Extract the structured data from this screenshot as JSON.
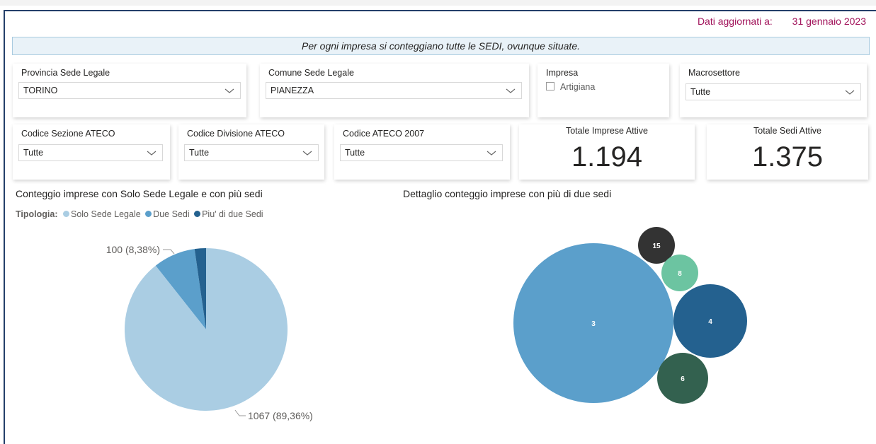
{
  "header": {
    "updated_label": "Dati aggiornati a:",
    "updated_date": "31 gennaio 2023",
    "note": "Per ogni impresa si conteggiano tutte le SEDI, ovunque situate."
  },
  "slicers": {
    "provincia": {
      "title": "Provincia Sede Legale",
      "value": "TORINO"
    },
    "comune": {
      "title": "Comune Sede Legale",
      "value": "PIANEZZA"
    },
    "impresa": {
      "title": "Impresa",
      "option": "Artigiana",
      "checked": false
    },
    "macrosettore": {
      "title": "Macrosettore",
      "value": "Tutte"
    },
    "sezione": {
      "title": "Codice Sezione ATECO",
      "value": "Tutte"
    },
    "divisione": {
      "title": "Codice Divisione ATECO",
      "value": "Tutte"
    },
    "ateco": {
      "title": "Codice ATECO 2007",
      "value": "Tutte"
    }
  },
  "kpis": {
    "imprese": {
      "title": "Totale Imprese Attive",
      "value": "1.194"
    },
    "sedi": {
      "title": "Totale Sedi Attive",
      "value": "1.375"
    }
  },
  "colors": {
    "solo_sede": "#aacde3",
    "due_sedi": "#5b9fcb",
    "piu_due": "#24618f",
    "accent": "#a1125a",
    "frame": "#243f6a"
  },
  "chart_data": [
    {
      "type": "pie",
      "title": "Conteggio imprese con Solo Sede Legale e con più sedi",
      "legend_title": "Tipologia:",
      "legend_position": "top-left",
      "series": [
        {
          "name": "Solo Sede Legale",
          "value": 1067,
          "label": "1067 (89,36%)",
          "color": "#aacde3"
        },
        {
          "name": "Due Sedi",
          "value": 100,
          "label": "100 (8,38%)",
          "color": "#5b9fcb"
        },
        {
          "name": "Piu' di due Sedi",
          "value": 27,
          "label": "",
          "color": "#24618f"
        }
      ]
    },
    {
      "type": "bubble",
      "title": "Dettaglio conteggio imprese con più di due sedi",
      "bubbles": [
        {
          "label": "3",
          "color": "#5b9fcb"
        },
        {
          "label": "15",
          "color": "#333333"
        },
        {
          "label": "8",
          "color": "#6cc4a1"
        },
        {
          "label": "4",
          "color": "#24618f"
        },
        {
          "label": "6",
          "color": "#33614f"
        }
      ]
    }
  ]
}
